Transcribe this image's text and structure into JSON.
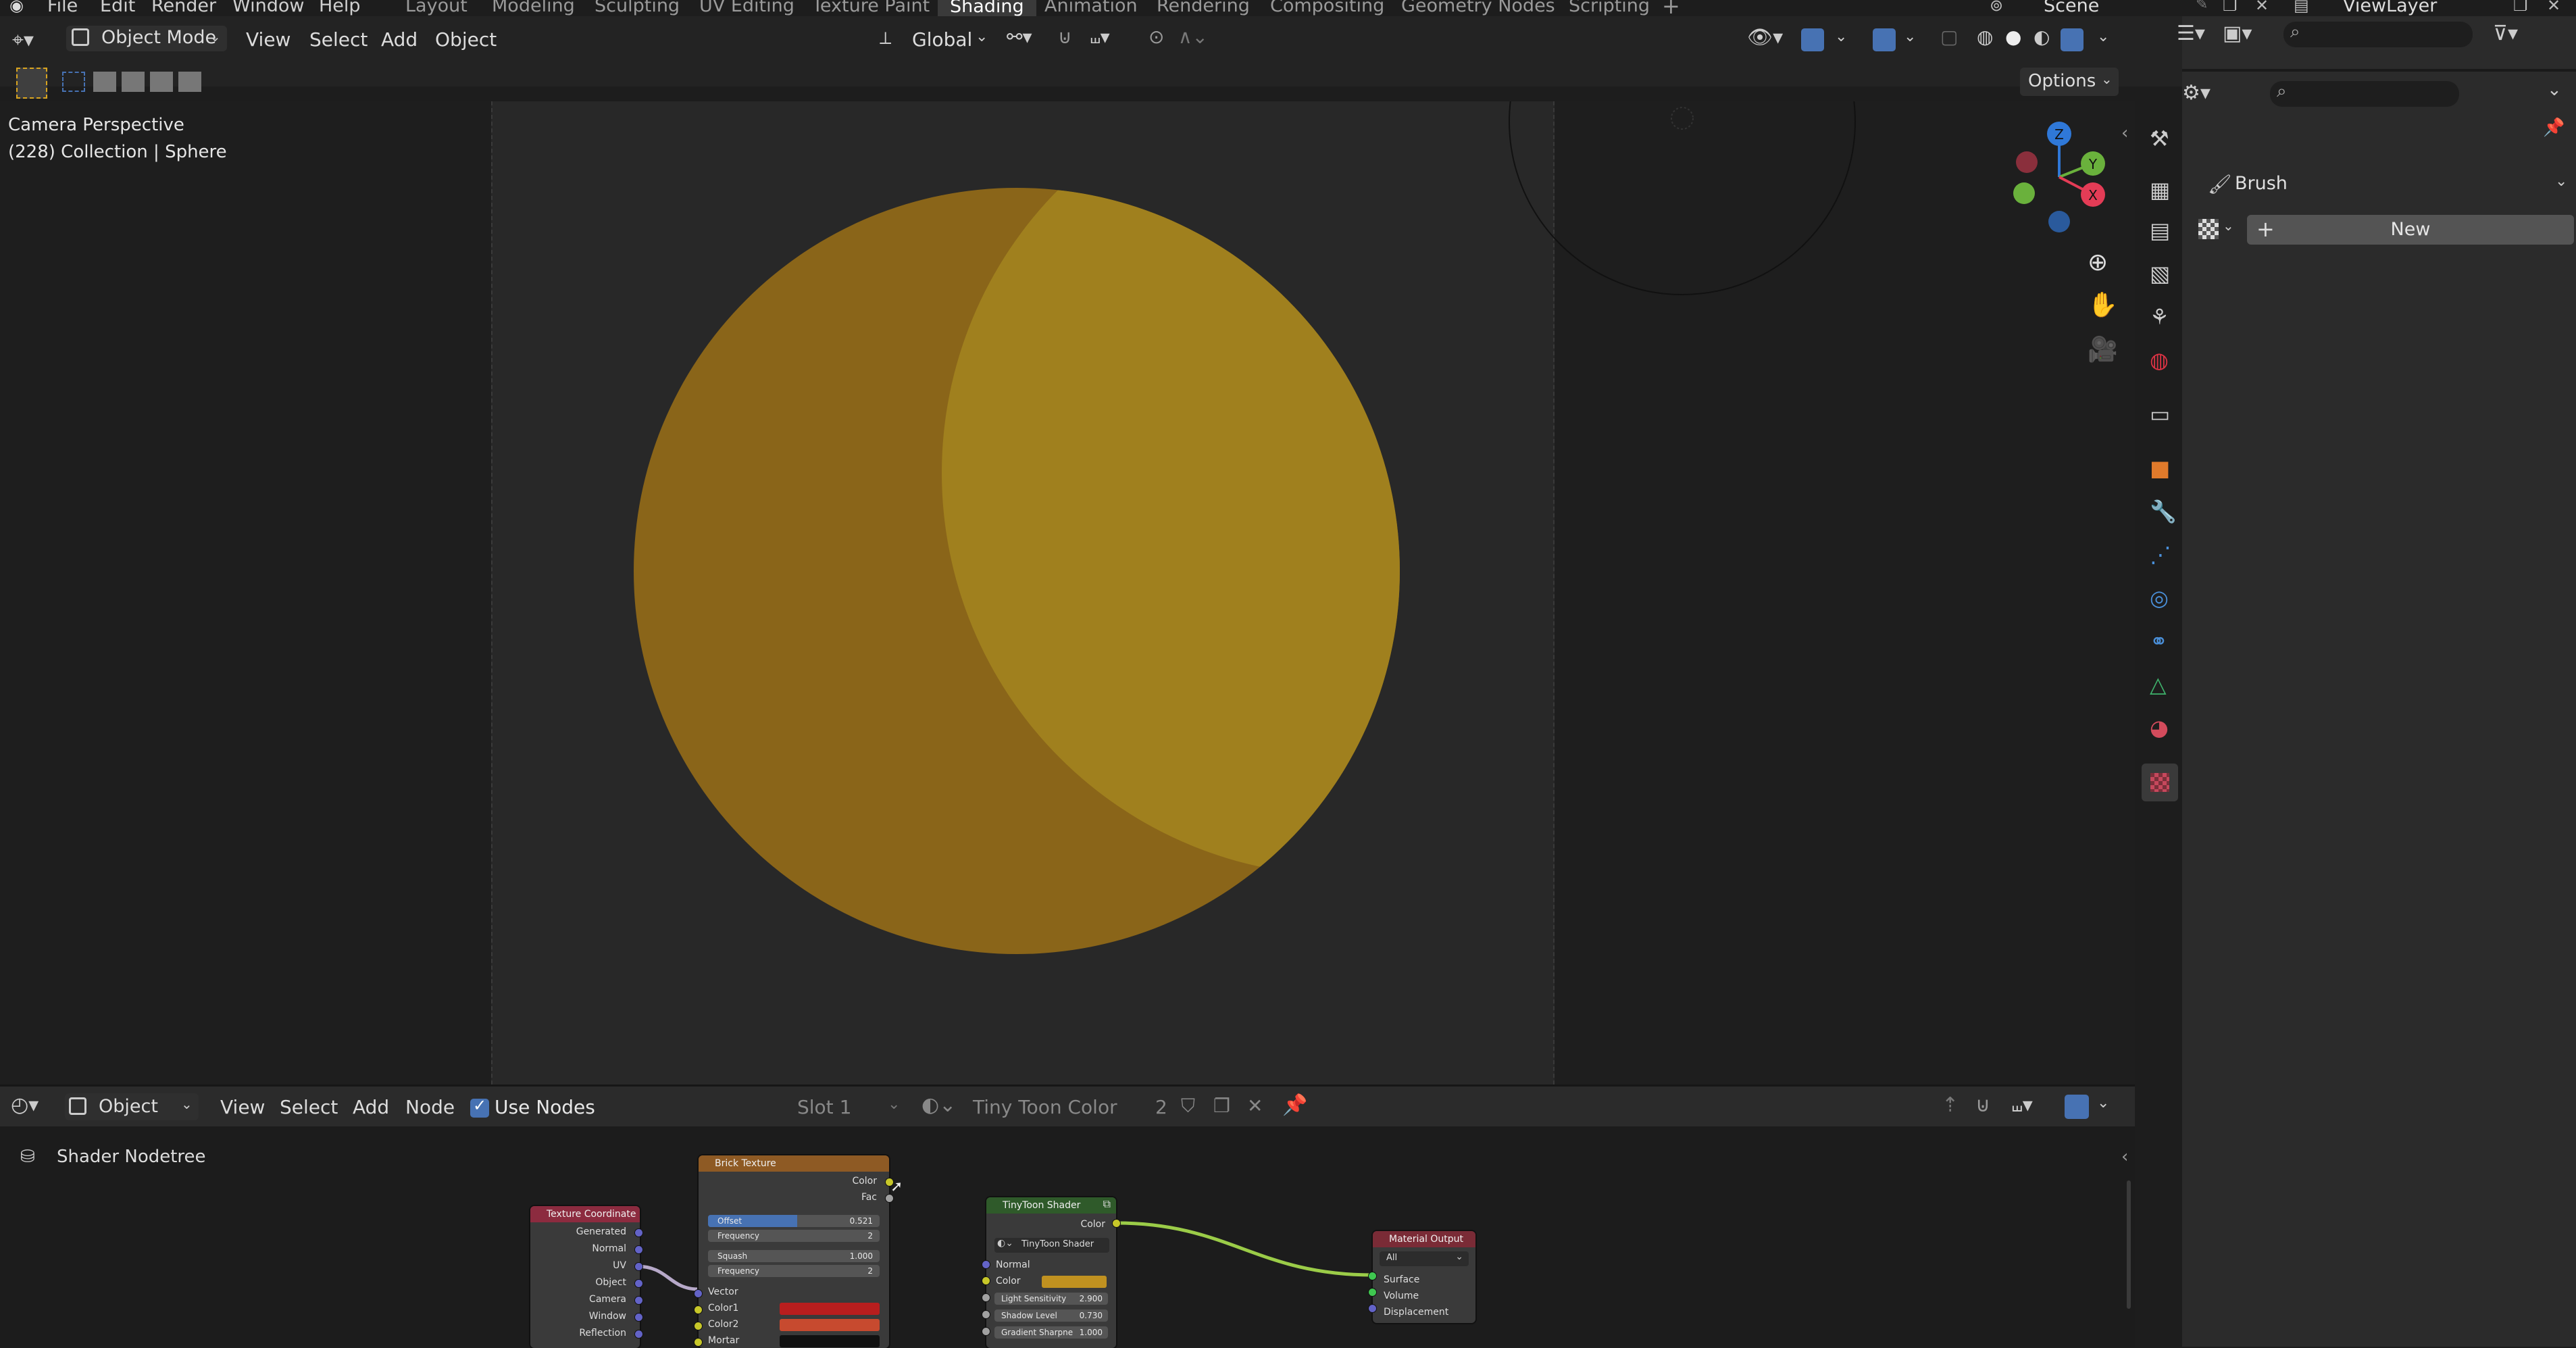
{
  "menu": [
    "File",
    "Edit",
    "Render",
    "Window",
    "Help"
  ],
  "workspaces": [
    "Layout",
    "Modeling",
    "Sculpting",
    "UV Editing",
    "Texture Paint",
    "Shading",
    "Animation",
    "Rendering",
    "Compositing",
    "Geometry Nodes",
    "Scripting"
  ],
  "scene": "Scene",
  "view_layer": "ViewLayer",
  "viewport": {
    "mode": "Object Mode",
    "menus": [
      "View",
      "Select",
      "Add",
      "Object"
    ],
    "transform_orientation": "Global",
    "options_label": "Options",
    "info_line1": "Camera Perspective",
    "info_line2": "(228) Collection | Sphere",
    "gizmo": {
      "z": "Z",
      "y": "Y",
      "x": "X"
    }
  },
  "properties": {
    "brush_label": "Brush",
    "new_label": "New"
  },
  "node_editor": {
    "mode": "Object",
    "menus": [
      "View",
      "Select",
      "Add",
      "Node"
    ],
    "use_nodes_label": "Use Nodes",
    "slot": "Slot 1",
    "material": "Tiny Toon Color",
    "users": "2",
    "breadcrumb": "Shader Nodetree",
    "nodes": {
      "texcoord": {
        "title": "Texture Coordinate",
        "outputs": [
          "Generated",
          "Normal",
          "UV",
          "Object",
          "Camera",
          "Window",
          "Reflection"
        ]
      },
      "brick": {
        "title": "Brick Texture",
        "outputs": [
          "Color",
          "Fac"
        ],
        "offset_label": "Offset",
        "offset_value": "0.521",
        "freq1_label": "Frequency",
        "freq1_value": "2",
        "squash_label": "Squash",
        "squash_value": "1.000",
        "freq2_label": "Frequency",
        "freq2_value": "2",
        "inputs": [
          "Vector",
          "Color1",
          "Color2",
          "Mortar"
        ]
      },
      "toon": {
        "title": "TinyToon Shader",
        "output": "Color",
        "group": "TinyToon Shader",
        "inputs": [
          "Normal",
          "Color"
        ],
        "light_label": "Light Sensitivity",
        "light_value": "2.900",
        "shadow_label": "Shadow Level",
        "shadow_value": "0.730",
        "gradient_label": "Gradient Sharpne",
        "gradient_value": "1.000"
      },
      "output": {
        "title": "Material Output",
        "target": "All",
        "inputs": [
          "Surface",
          "Volume",
          "Displacement"
        ]
      }
    }
  },
  "colors": {
    "sphere_light": "#a0801e",
    "sphere_dark": "#8a6519",
    "accent_blue": "#4772b3",
    "toon_color": "#c09120",
    "color1": "#b81e1e",
    "color2": "#c74a2f"
  }
}
